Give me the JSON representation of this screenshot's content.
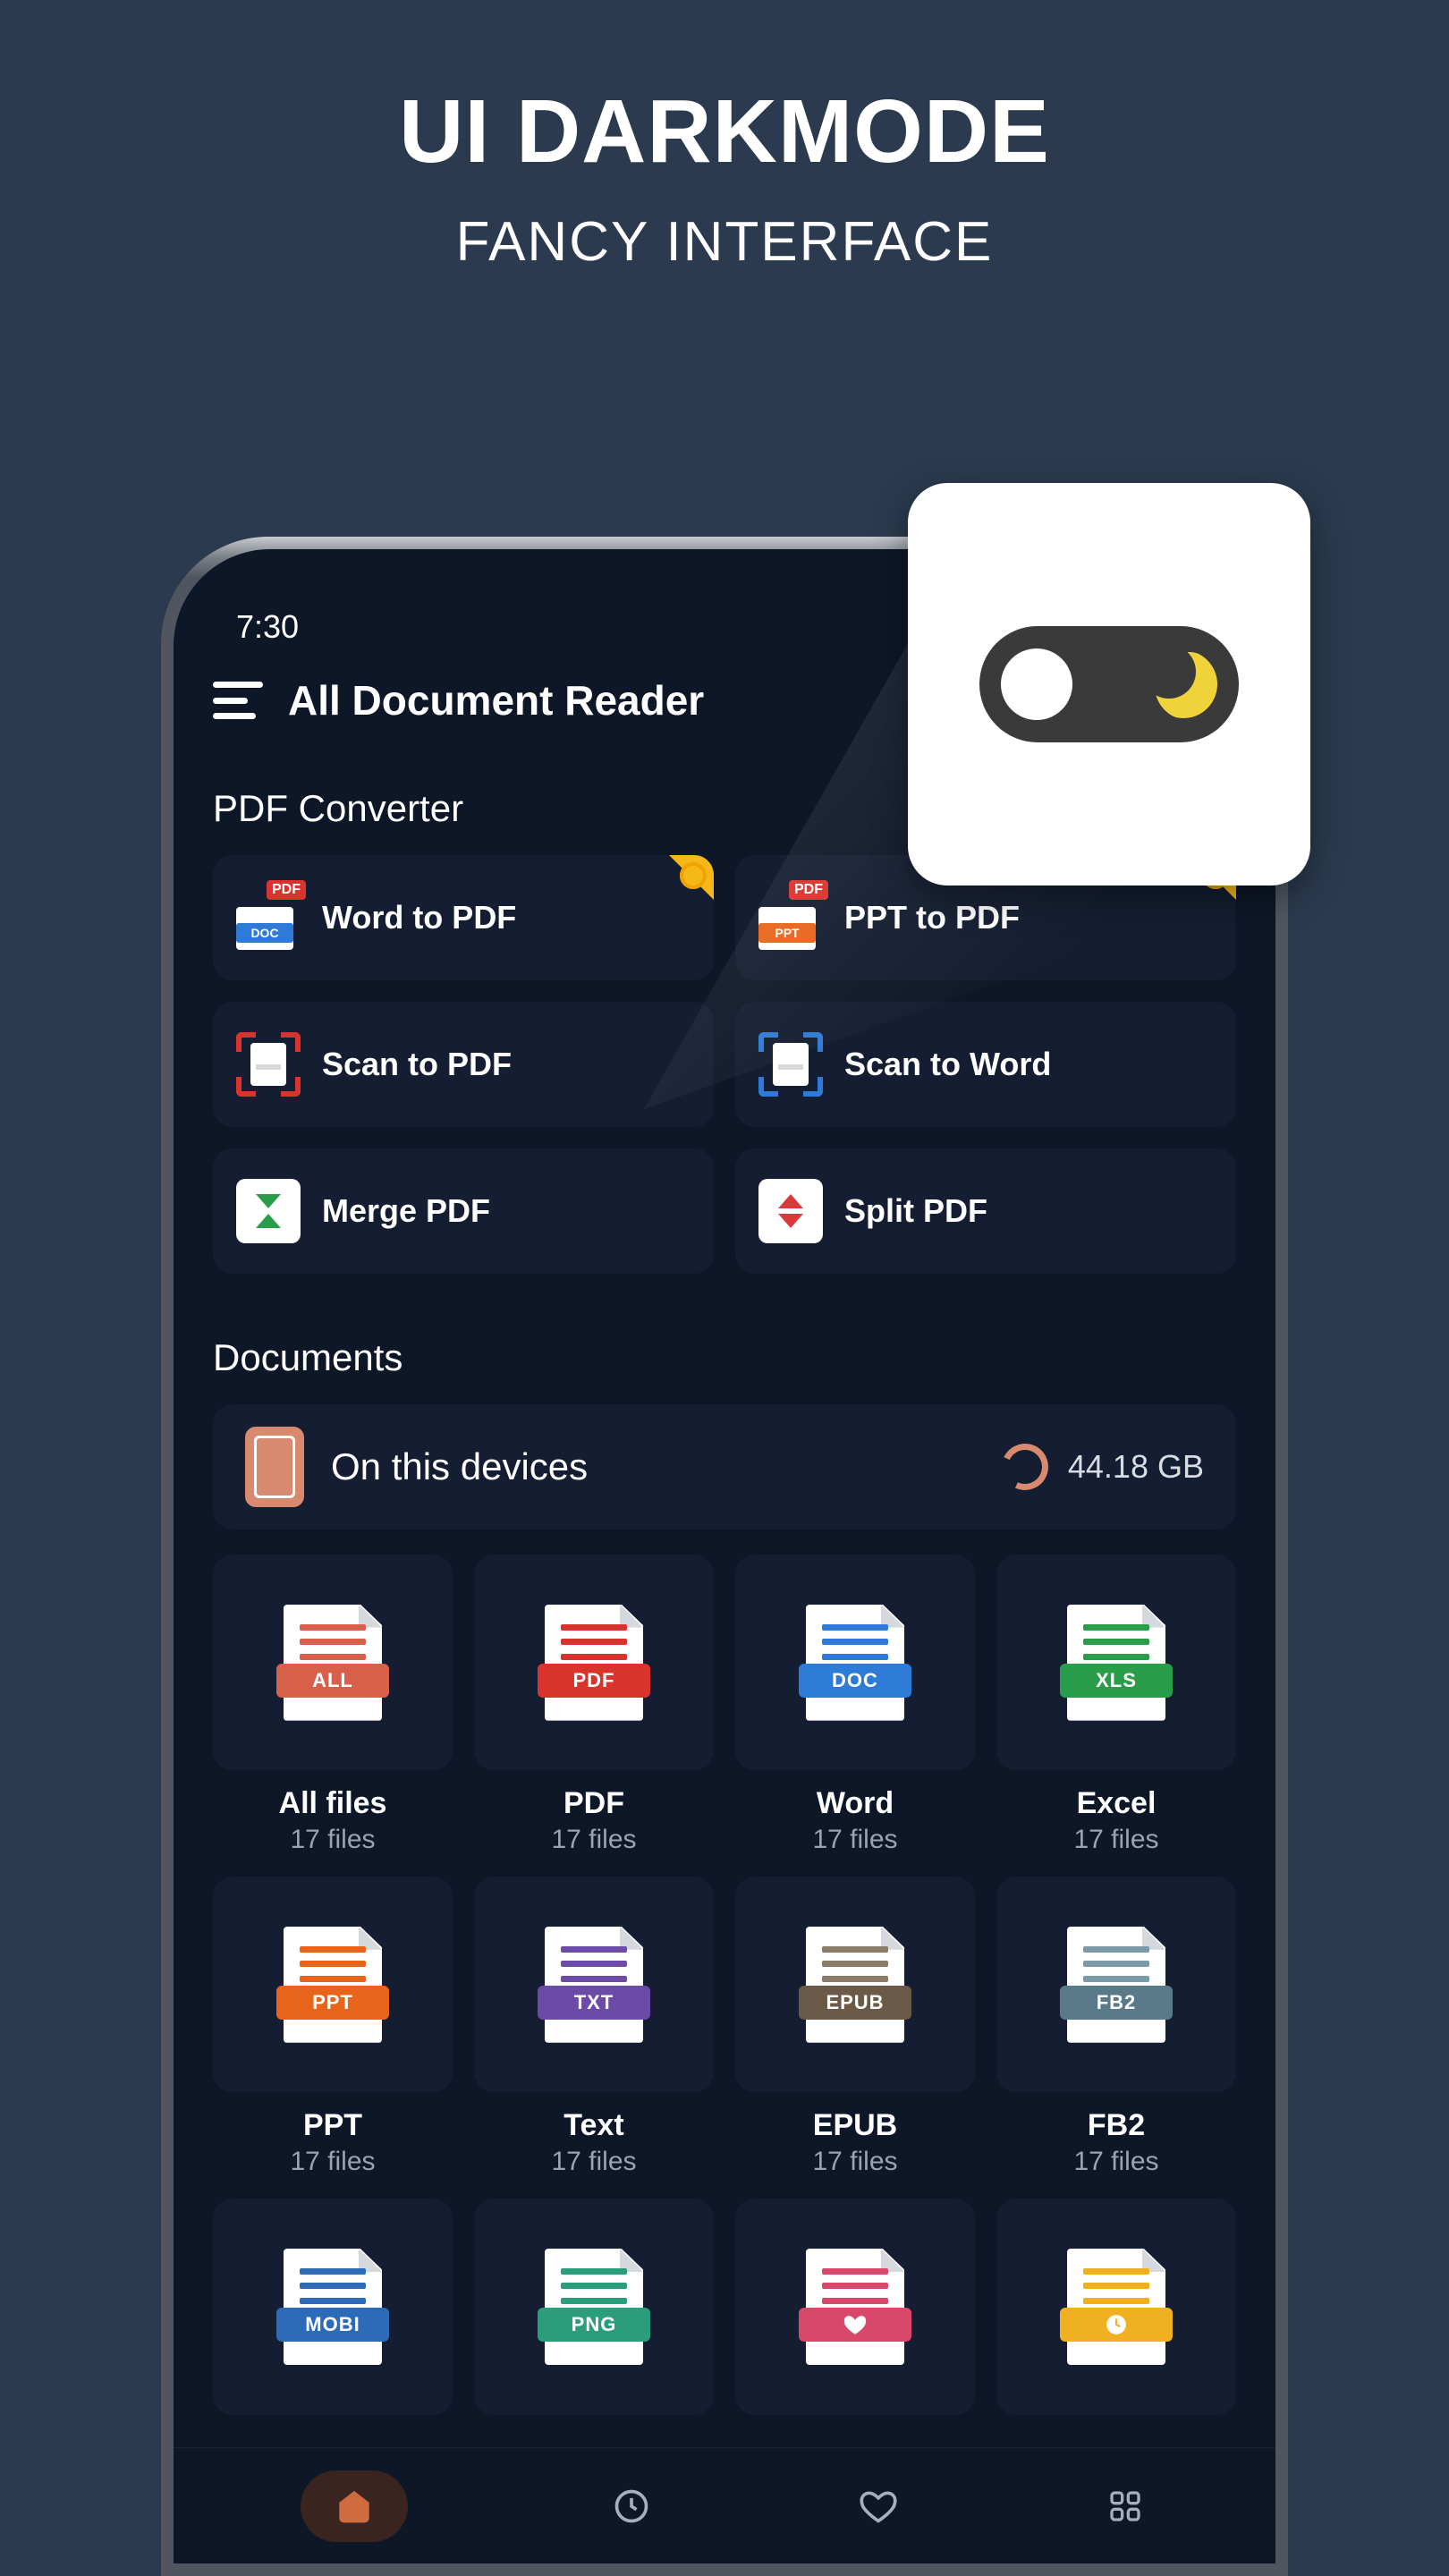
{
  "hero": {
    "title": "UI DARKMODE",
    "subtitle": "FANCY INTERFACE"
  },
  "status": {
    "time": "7:30"
  },
  "header": {
    "title": "All Document Reader"
  },
  "converter": {
    "title": "PDF Converter",
    "items": [
      {
        "label": "Word to PDF",
        "badge_top": "PDF",
        "badge_bot": "DOC",
        "premium": true
      },
      {
        "label": "PPT to PDF",
        "badge_top": "PDF",
        "badge_bot": "PPT",
        "premium": true
      },
      {
        "label": "Scan to PDF"
      },
      {
        "label": "Scan to Word"
      },
      {
        "label": "Merge PDF"
      },
      {
        "label": "Split PDF"
      }
    ]
  },
  "documents": {
    "title": "Documents",
    "device_label": "On this devices",
    "storage": "44.18 GB",
    "items": [
      {
        "name": "All files",
        "count": "17 files",
        "badge": "ALL",
        "color": "#d8604a",
        "line": "#d8604a"
      },
      {
        "name": "PDF",
        "count": "17 files",
        "badge": "PDF",
        "color": "#d8332c",
        "line": "#d8332c"
      },
      {
        "name": "Word",
        "count": "17 files",
        "badge": "DOC",
        "color": "#2d7bd6",
        "line": "#2d7bd6"
      },
      {
        "name": "Excel",
        "count": "17 files",
        "badge": "XLS",
        "color": "#2a9d4a",
        "line": "#2a9d4a"
      },
      {
        "name": "PPT",
        "count": "17 files",
        "badge": "PPT",
        "color": "#e8641b",
        "line": "#e8641b"
      },
      {
        "name": "Text",
        "count": "17 files",
        "badge": "TXT",
        "color": "#6b4aa8",
        "line": "#6b4aa8"
      },
      {
        "name": "EPUB",
        "count": "17 files",
        "badge": "EPUB",
        "color": "#6b5a47",
        "line": "#8a7a68"
      },
      {
        "name": "FB2",
        "count": "17 files",
        "badge": "FB2",
        "color": "#5a7a8a",
        "line": "#7a9aaa"
      },
      {
        "name": "",
        "count": "",
        "badge": "MOBI",
        "color": "#2d6bb8",
        "line": "#2d6bb8"
      },
      {
        "name": "",
        "count": "",
        "badge": "PNG",
        "color": "#2a9d7a",
        "line": "#2a9d7a"
      },
      {
        "name": "",
        "count": "",
        "badge": "",
        "color": "#d8486a",
        "line": "#d8486a",
        "icon": "heart"
      },
      {
        "name": "",
        "count": "",
        "badge": "",
        "color": "#f0b020",
        "line": "#f0b020",
        "icon": "clock"
      }
    ]
  },
  "nav": {
    "items": [
      {
        "id": "home"
      },
      {
        "id": "recent"
      },
      {
        "id": "favorite"
      },
      {
        "id": "tools"
      }
    ]
  }
}
